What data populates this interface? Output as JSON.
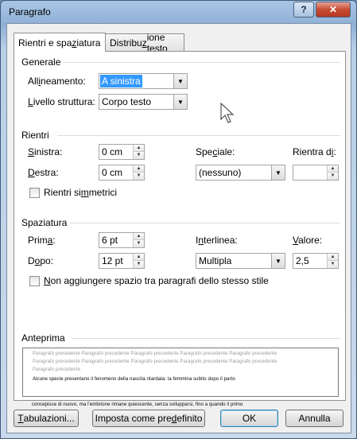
{
  "window": {
    "title": "Paragrafo",
    "help_label": "?",
    "close_label": "✕"
  },
  "tabs": [
    {
      "label_pre": "Rientri e spa",
      "label_u": "z",
      "label_post": "iatura",
      "active": true
    },
    {
      "label_pre": "Distribu",
      "label_u": "z",
      "label_post": "ione testo",
      "active": false
    }
  ],
  "generale": {
    "title": "Generale",
    "allineamento": {
      "label_pre": "All",
      "label_u": "i",
      "label_post": "neamento:",
      "value": "A sinistra"
    },
    "livello": {
      "label_pre": "",
      "label_u": "L",
      "label_post": "ivello struttura:",
      "value": "Corpo testo"
    }
  },
  "rientri": {
    "title": "Rientri",
    "sinistra": {
      "label_pre": "",
      "label_u": "S",
      "label_post": "inistra:",
      "value": "0 cm"
    },
    "destra": {
      "label_pre": "",
      "label_u": "D",
      "label_post": "estra:",
      "value": "0 cm"
    },
    "speciale": {
      "label_pre": "Spe",
      "label_u": "c",
      "label_post": "iale:",
      "value": "(nessuno)"
    },
    "rientra_di": {
      "label_pre": "Rientra d",
      "label_u": "i",
      "label_post": ":",
      "value": ""
    },
    "simmetrici": {
      "label_pre": "Rientri si",
      "label_u": "m",
      "label_post": "metrici",
      "checked": false
    }
  },
  "spaziatura": {
    "title": "Spaziatura",
    "prima": {
      "label_pre": "Prim",
      "label_u": "a",
      "label_post": ":",
      "value": "6 pt"
    },
    "dopo": {
      "label_pre": "D",
      "label_u": "o",
      "label_post": "po:",
      "value": "12 pt"
    },
    "interlinea": {
      "label_pre": "I",
      "label_u": "n",
      "label_post": "terlinea:",
      "value": "Multipla"
    },
    "valore": {
      "label_pre": "",
      "label_u": "V",
      "label_post": "alore:",
      "value": "2,5"
    },
    "non_aggiungere": {
      "label_pre": "",
      "label_u": "N",
      "label_post": "on aggiungere spazio tra paragrafi dello stesso stile",
      "checked": false
    }
  },
  "anteprima": {
    "title": "Anteprima",
    "prev_lines": [
      "Paragrafo precedente Paragrafo precedente Paragrafo precedente Paragrafo precedente Paragrafo precedente",
      "Paragrafo precedente Paragrafo precedente Paragrafo precedente Paragrafo precedente Paragrafo precedente",
      "Paragrafo precedente"
    ],
    "text_lines": [
      "Alcune specie presentano il fenomeno della nascita ritardata: la femmina subito dopo il parto",
      "concepisce di nuovo, ma l'embrione rimane quiescente, senza svilupparsi, fino a quando il primo"
    ]
  },
  "buttons": {
    "tabulazioni": {
      "pre": "",
      "u": "T",
      "post": "abulazioni..."
    },
    "imposta": {
      "pre": "Imposta come pre",
      "u": "d",
      "post": "efinito"
    },
    "ok": "OK",
    "annulla": "Annulla"
  },
  "icons": {
    "dropdown": "chevron-down-icon",
    "spin": "spin-arrows-icon",
    "cursor": "mouse-pointer-icon"
  }
}
